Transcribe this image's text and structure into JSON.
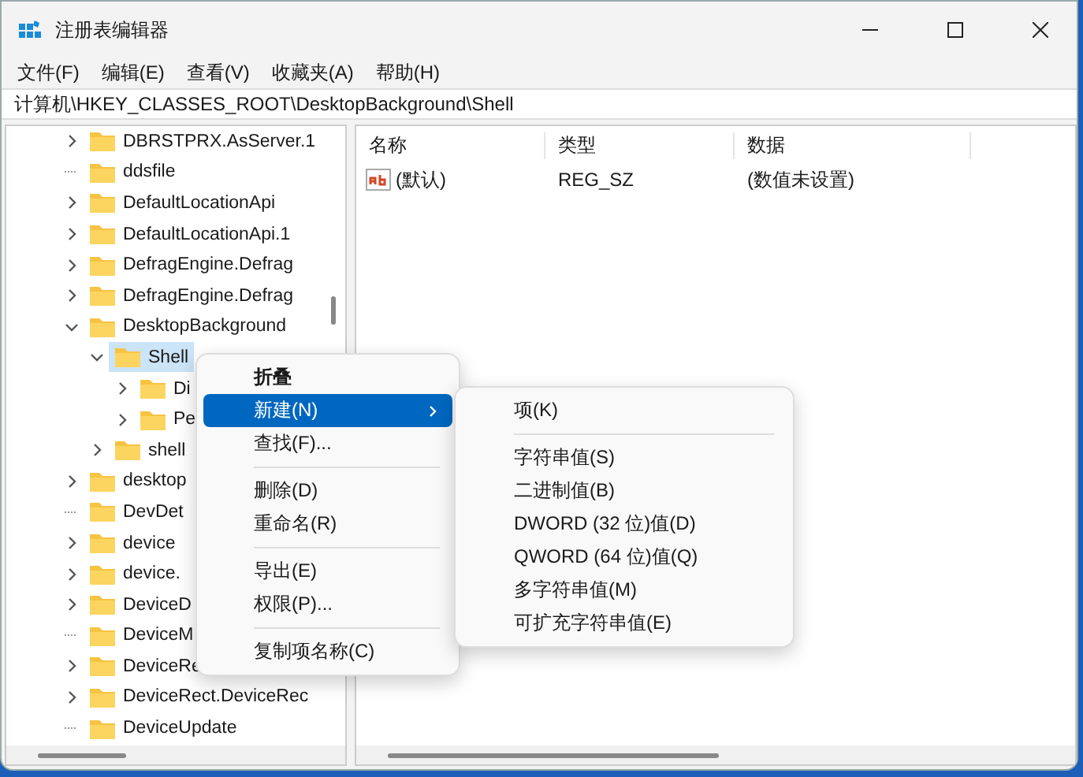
{
  "window": {
    "title": "注册表编辑器"
  },
  "menu_bar": [
    "文件(F)",
    "编辑(E)",
    "查看(V)",
    "收藏夹(A)",
    "帮助(H)"
  ],
  "address": "计算机\\HKEY_CLASSES_ROOT\\DesktopBackground\\Shell",
  "tree": [
    {
      "label": "DBRSTPRX.AsServer.1",
      "expandable": true,
      "expanded": false,
      "selected": false
    },
    {
      "label": "ddsfile",
      "expandable": false,
      "selected": false
    },
    {
      "label": "DefaultLocationApi",
      "expandable": true,
      "expanded": false,
      "selected": false
    },
    {
      "label": "DefaultLocationApi.1",
      "expandable": true,
      "expanded": false,
      "selected": false
    },
    {
      "label": "DefragEngine.Defrag",
      "expandable": true,
      "expanded": false,
      "selected": false
    },
    {
      "label": "DefragEngine.Defrag",
      "expandable": true,
      "expanded": false,
      "selected": false
    },
    {
      "label": "DesktopBackground",
      "expandable": true,
      "expanded": true,
      "selected": false,
      "children": [
        {
          "label": "Shell",
          "expandable": true,
          "expanded": true,
          "selected": true,
          "children": [
            {
              "label": "Di",
              "expandable": true,
              "expanded": false,
              "selected": false
            },
            {
              "label": "Pe",
              "expandable": true,
              "expanded": false,
              "selected": false
            }
          ]
        },
        {
          "label": "shell",
          "expandable": true,
          "expanded": false,
          "selected": false
        }
      ]
    },
    {
      "label": "desktop",
      "expandable": true,
      "expanded": false,
      "selected": false
    },
    {
      "label": "DevDet",
      "expandable": false,
      "selected": false
    },
    {
      "label": "device",
      "expandable": true,
      "expanded": false,
      "selected": false
    },
    {
      "label": "device.",
      "expandable": true,
      "expanded": false,
      "selected": false
    },
    {
      "label": "DeviceD",
      "expandable": true,
      "expanded": false,
      "selected": false
    },
    {
      "label": "DeviceM",
      "expandable": false,
      "selected": false
    },
    {
      "label": "DeviceRe",
      "expandable": true,
      "expanded": false,
      "selected": false
    },
    {
      "label": "DeviceRect.DeviceRec",
      "expandable": true,
      "expanded": false,
      "selected": false
    },
    {
      "label": "DeviceUpdate",
      "expandable": false,
      "selected": false
    }
  ],
  "values_table": {
    "columns": [
      "名称",
      "类型",
      "数据"
    ],
    "rows": [
      {
        "name": "(默认)",
        "type": "REG_SZ",
        "data": "(数值未设置)"
      }
    ]
  },
  "context_menu": [
    {
      "kind": "item",
      "label": "折叠",
      "default": true,
      "selected": false,
      "submenu": false
    },
    {
      "kind": "item",
      "label": "新建(N)",
      "default": false,
      "selected": true,
      "submenu": true
    },
    {
      "kind": "item",
      "label": "查找(F)...",
      "default": false,
      "selected": false,
      "submenu": false
    },
    {
      "kind": "separator"
    },
    {
      "kind": "item",
      "label": "删除(D)",
      "default": false,
      "selected": false,
      "submenu": false
    },
    {
      "kind": "item",
      "label": "重命名(R)",
      "default": false,
      "selected": false,
      "submenu": false
    },
    {
      "kind": "separator"
    },
    {
      "kind": "item",
      "label": "导出(E)",
      "default": false,
      "selected": false,
      "submenu": false
    },
    {
      "kind": "item",
      "label": "权限(P)...",
      "default": false,
      "selected": false,
      "submenu": false
    },
    {
      "kind": "separator"
    },
    {
      "kind": "item",
      "label": "复制项名称(C)",
      "default": false,
      "selected": false,
      "submenu": false
    }
  ],
  "submenu": [
    {
      "kind": "item",
      "label": "项(K)"
    },
    {
      "kind": "separator"
    },
    {
      "kind": "item",
      "label": "字符串值(S)"
    },
    {
      "kind": "item",
      "label": "二进制值(B)"
    },
    {
      "kind": "item",
      "label": "DWORD (32 位)值(D)"
    },
    {
      "kind": "item",
      "label": "QWORD (64 位)值(Q)"
    },
    {
      "kind": "item",
      "label": "多字符串值(M)"
    },
    {
      "kind": "item",
      "label": "可扩充字符串值(E)"
    }
  ]
}
